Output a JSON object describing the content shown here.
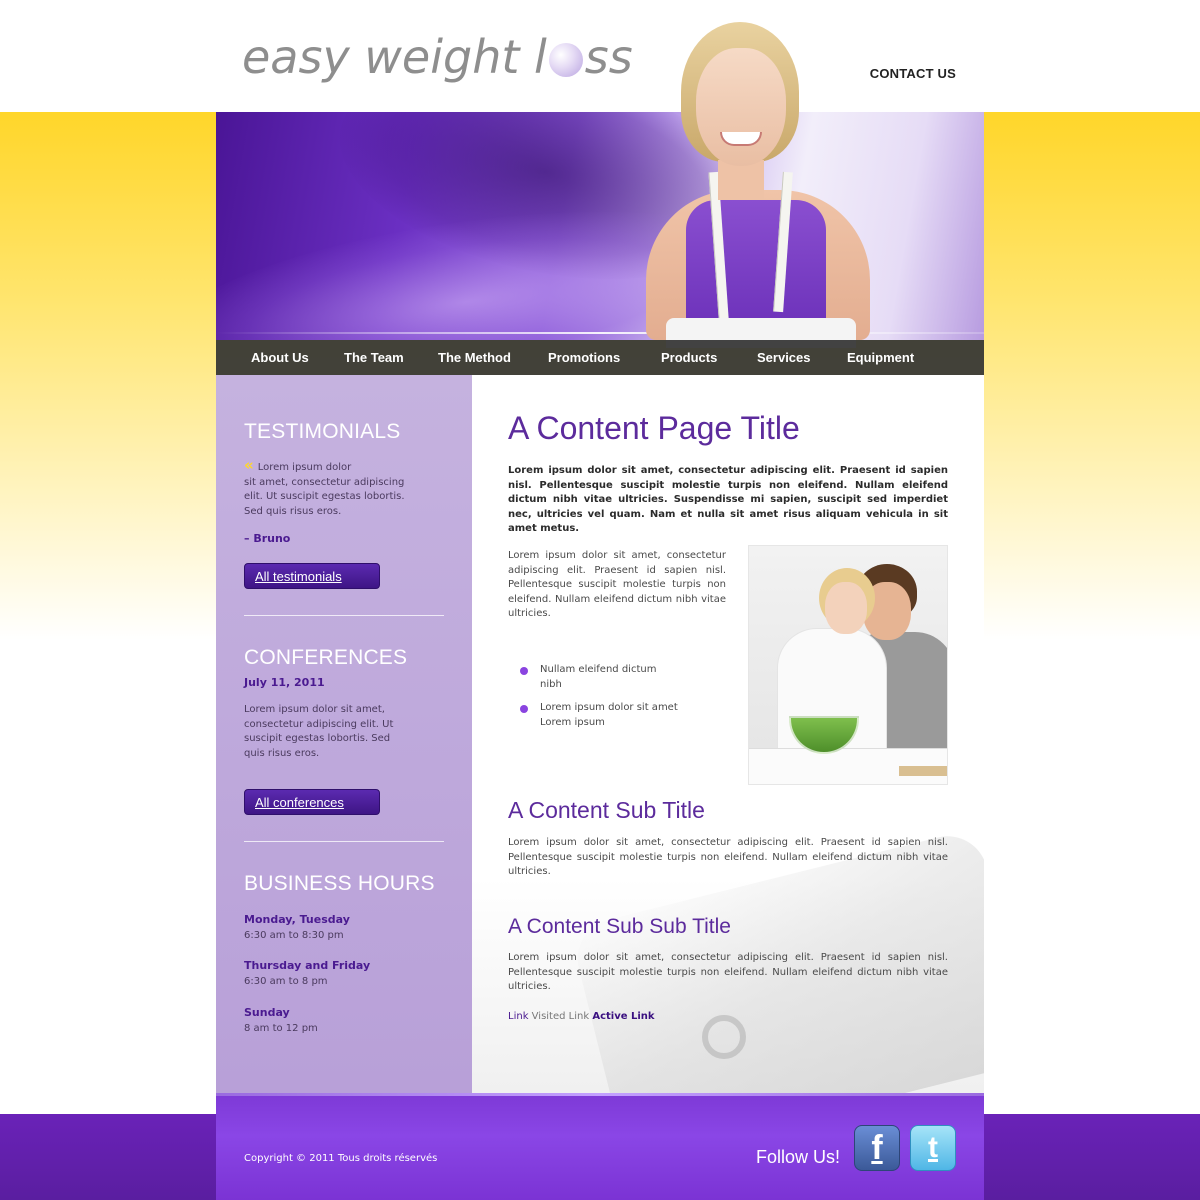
{
  "header": {
    "logo_pre": "easy weight l",
    "logo_post": "ss",
    "contact": "CONTACT US"
  },
  "nav": {
    "items": [
      "About Us",
      "The Team",
      "The Method",
      "Promotions",
      "Products",
      "Services",
      "Equipment"
    ]
  },
  "sidebar": {
    "testimonials": {
      "title": "TESTIMONIALS",
      "quote_mark": "«",
      "text_line1": "Lorem ipsum dolor",
      "text_rest": "sit amet, consectetur adipiscing elit. Ut suscipit egestas lobortis. Sed quis risus eros.",
      "author": "– Bruno",
      "button": "All testimonials"
    },
    "conferences": {
      "title": "CONFERENCES",
      "date": "July 11, 2011",
      "text": "Lorem ipsum dolor sit amet, consectetur adipiscing elit. Ut suscipit egestas lobortis. Sed quis risus eros.",
      "button": "All conferences"
    },
    "hours": {
      "title": "BUSINESS HOURS",
      "rows": [
        {
          "days": "Monday, Tuesday",
          "time": "6:30 am to 8:30 pm"
        },
        {
          "days": "Thursday and Friday",
          "time": "6:30 am to 8 pm"
        },
        {
          "days": "Sunday",
          "time": "8 am to 12 pm"
        }
      ]
    }
  },
  "main": {
    "title": "A Content Page Title",
    "lead": "Lorem ipsum dolor sit amet, consectetur adipiscing elit. Praesent id sapien nisl. Pellentesque suscipit molestie turpis non eleifend. Nullam eleifend dictum nibh vitae ultricies. Suspendisse mi sapien, suscipit sed imperdiet nec, ultricies vel quam. Nam et nulla sit amet risus aliquam vehicula in sit amet metus.",
    "intro": "Lorem ipsum dolor sit amet, consectetur adipiscing elit. Praesent id sapien nisl. Pellentesque suscipit molestie turpis non eleifend. Nullam eleifend dictum nibh vitae ultricies.",
    "bullets": [
      "Nullam eleifend dictum nibh",
      "Lorem ipsum dolor sit amet Lorem ipsum"
    ],
    "sub_title": "A Content Sub Title",
    "sub_text": "Lorem ipsum dolor sit amet, consectetur adipiscing elit. Praesent id sapien nisl. Pellentesque suscipit molestie turpis non eleifend. Nullam eleifend dictum nibh vitae ultricies.",
    "subsub_title": "A Content Sub Sub Title",
    "subsub_text": "Lorem ipsum dolor sit amet, consectetur adipiscing elit. Praesent id sapien nisl. Pellentesque suscipit molestie turpis non eleifend. Nullam eleifend dictum nibh vitae ultricies.",
    "links": {
      "link": "Link",
      "visited": "Visited Link",
      "active": "Active Link"
    }
  },
  "footer": {
    "copyright": "Copyright © 2011 Tous droits réservés",
    "follow": "Follow Us!",
    "facebook_glyph": "f",
    "twitter_glyph": "t"
  },
  "colors": {
    "brand_purple": "#5c2b9c",
    "accent_yellow": "#ffd62a",
    "footer_purple": "#7d39d6"
  },
  "icons": [
    "logo-ball-icon",
    "quote-icon",
    "bullet-dot-icon",
    "facebook-icon",
    "twitter-icon"
  ]
}
